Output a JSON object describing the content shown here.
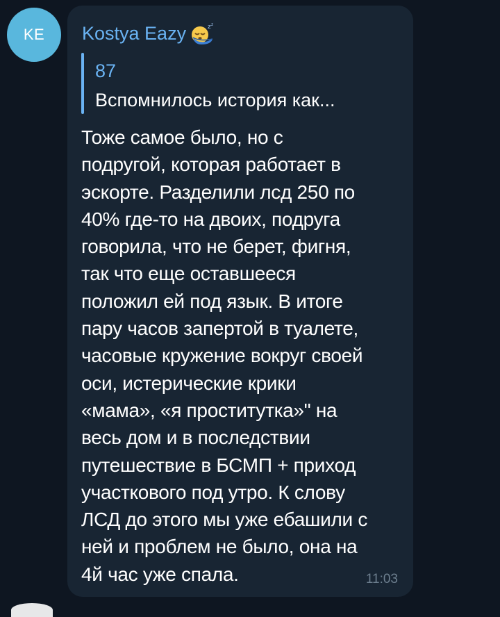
{
  "chat": {
    "avatar_initials": "KE",
    "avatar_color": "#59b7dd",
    "sender_name": "Kostya Eazy",
    "sender_emoji_icon": "sleeping-face-emoji-icon",
    "reply": {
      "author": "87",
      "text": "Вспомнилось история как..."
    },
    "message_lines": [
      "Тоже самое было, но с",
      "подругой, которая работает в",
      "эскорте. Разделили лсд 250 по",
      "40% где-то на двоих, подруга",
      "говорила, что не берет, фигня,",
      "так что еще оставшееся",
      "положил ей под язык. В итоге",
      "пару часов запертой в туалете,",
      "часовые кружение вокруг своей",
      "оси, истерические крики",
      "«мама», «я проститутка»\" на",
      "весь дом и в последствии",
      "путешествие в БСМП + приход",
      "участкового под утро. К слову",
      "ЛСД до этого мы уже ебашили с",
      "ней и проблем не было, она на",
      "4й час уже спала."
    ],
    "time": "11:03"
  },
  "colors": {
    "background": "#0e1621",
    "bubble": "#182533",
    "accent": "#6ab3f3",
    "text": "#ffffff",
    "time": "#6d7f8f"
  }
}
